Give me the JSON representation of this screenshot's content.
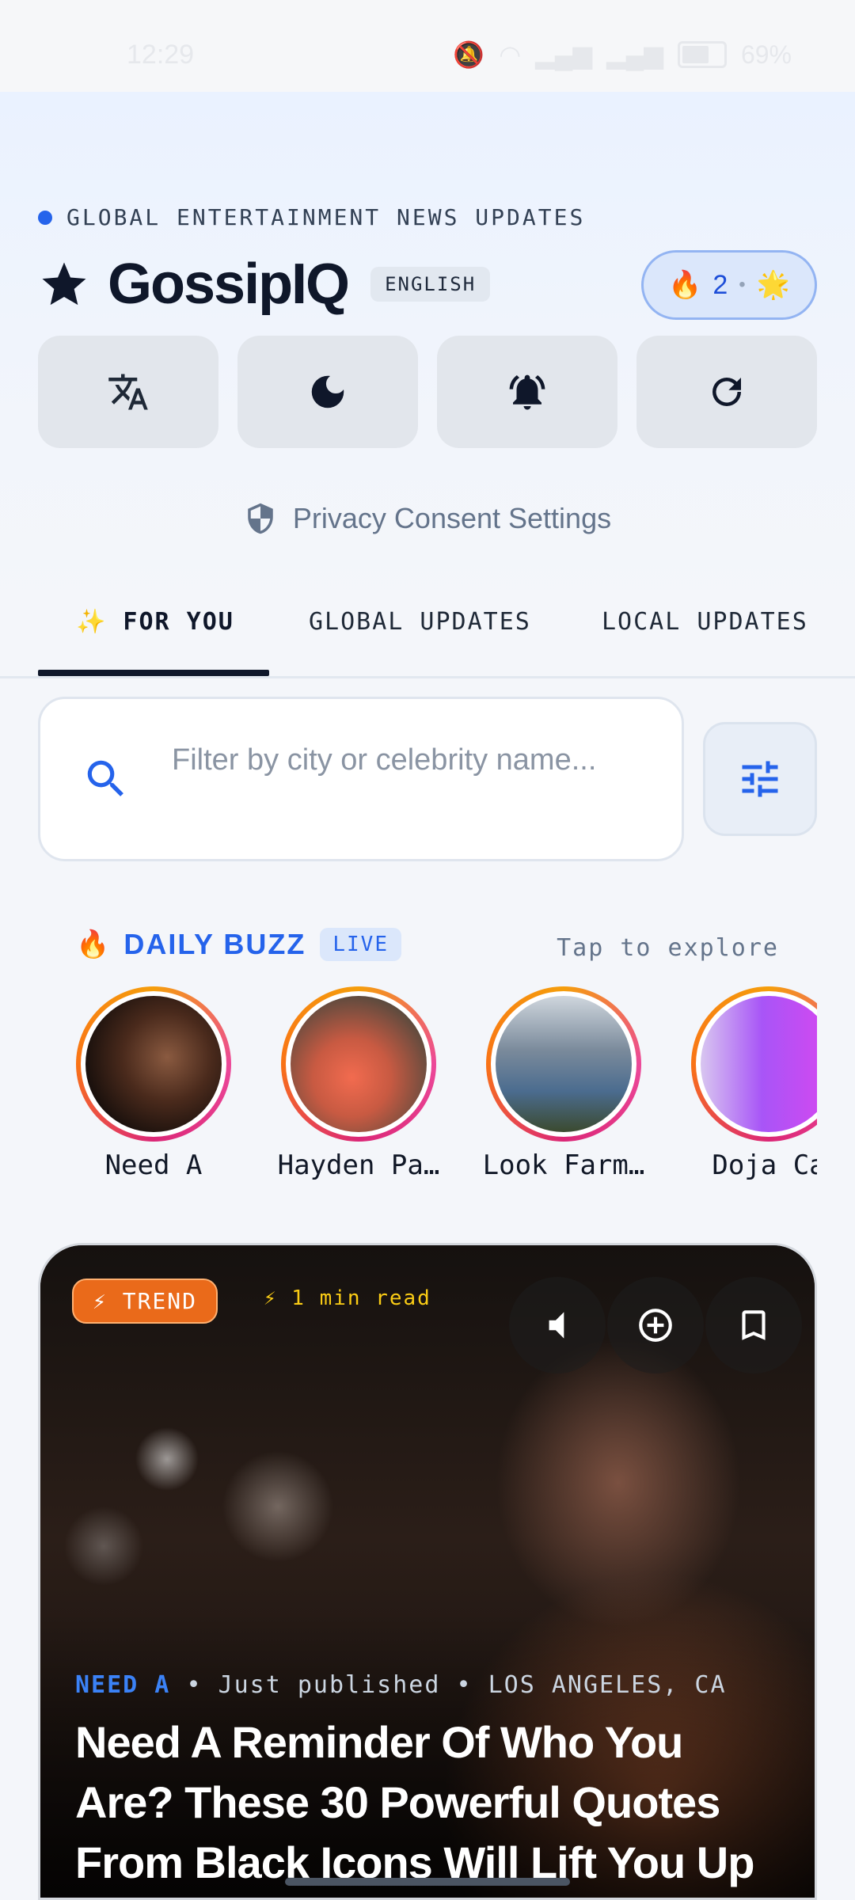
{
  "status_bar": {
    "time": "12:29",
    "battery": "69%",
    "battery_level": 0.69
  },
  "header": {
    "tagline": "GLOBAL ENTERTAINMENT NEWS UPDATES",
    "app_name": "GossipIQ",
    "language": "ENGLISH",
    "streak": {
      "fire": "🔥",
      "count": "2",
      "sun": "🌟",
      "separator": "•"
    }
  },
  "actions": [
    {
      "icon": "translate-icon"
    },
    {
      "icon": "moon-icon"
    },
    {
      "icon": "bell-icon"
    },
    {
      "icon": "refresh-icon"
    }
  ],
  "privacy": {
    "label": "Privacy Consent Settings",
    "icon": "shield-icon"
  },
  "tabs": {
    "for_you": "✨ FOR YOU",
    "global": "GLOBAL UPDATES",
    "local": "LOCAL UPDATES",
    "active": "for_you"
  },
  "search": {
    "placeholder": "Filter by city or celebrity name..."
  },
  "buzz": {
    "emoji": "🔥",
    "title": "DAILY BUZZ",
    "badge": "LIVE",
    "hint": "Tap to explore",
    "stories": [
      {
        "label": "Need A"
      },
      {
        "label": "Hayden Pa…"
      },
      {
        "label": "Look Farm…"
      },
      {
        "label": "Doja Ca"
      }
    ]
  },
  "card": {
    "badge": "⚡ TREND",
    "read_time": "⚡ 1 min read",
    "category": "NEED A",
    "published": "Just published",
    "location": "LOS ANGELES, CA",
    "meta_sep": "•",
    "headline": "Need A Reminder Of Who You Are? These 30 Powerful Quotes From Black Icons Will Lift You Up"
  }
}
